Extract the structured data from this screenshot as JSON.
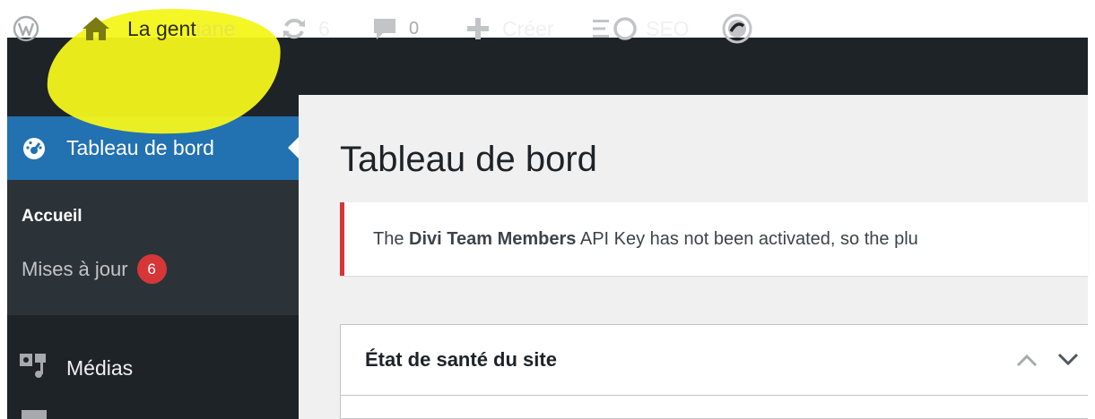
{
  "toolbar": {
    "site_name_prefix": "La gent",
    "site_name_suffix": "iane",
    "updates_count": "6",
    "comments_count": "0",
    "new_label": "Créer",
    "seo_label": "SEO"
  },
  "sidebar": {
    "dashboard_label": "Tableau de bord",
    "submenu": {
      "home_label": "Accueil",
      "updates_label": "Mises à jour",
      "updates_badge": "6"
    },
    "media_label": "Médias"
  },
  "main": {
    "page_title": "Tableau de bord",
    "notice": {
      "text_before": "The ",
      "plugin_name": "Divi Team Members",
      "text_after": " API Key has not been activated, so the plu"
    },
    "postbox": {
      "title": "État de santé du site"
    }
  },
  "colors": {
    "admin_bar_bg": "#1d2327",
    "menu_active_bg": "#2271b1",
    "submenu_bg": "#2c3338",
    "notice_error_border": "#d63638",
    "badge_bg": "#d63638",
    "highlight_marker": "#f4f51a"
  },
  "icons": [
    "wordpress-logo-icon",
    "home-icon",
    "updates-icon",
    "comment-icon",
    "plus-icon",
    "seo-icon",
    "circular-logo-icon",
    "dashboard-gauge-icon",
    "media-icon",
    "chevron-up-icon",
    "chevron-down-icon"
  ]
}
